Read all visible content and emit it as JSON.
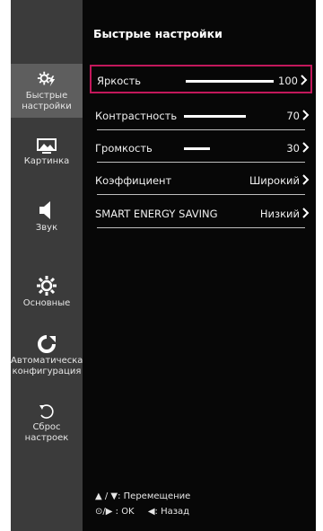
{
  "main": {
    "title": "Быстрые настройки"
  },
  "sidebar": {
    "items": [
      {
        "label": "Быстрые\nнастройки",
        "icon": "quick-settings-icon"
      },
      {
        "label": "Картинка",
        "icon": "picture-icon"
      },
      {
        "label": "Звук",
        "icon": "speaker-icon"
      },
      {
        "label": "Основные",
        "icon": "gear-icon"
      },
      {
        "label": "Автоматическая\nконфигурация",
        "icon": "auto-config-icon"
      },
      {
        "label": "Сброс\nнастроек",
        "icon": "reset-icon"
      }
    ]
  },
  "settings": [
    {
      "label": "Яркость",
      "value": "100",
      "level": 1.0
    },
    {
      "label": "Контрастность",
      "value": "70",
      "level": 0.7
    },
    {
      "label": "Громкость",
      "value": "30",
      "level": 0.3
    },
    {
      "label": "Коэффициент",
      "value": "Широкий"
    },
    {
      "label": "SMART ENERGY SAVING",
      "value": "Низкий"
    }
  ],
  "footer": {
    "move_symbol": "▲ / ▼",
    "move_label": ": Перемещение",
    "ok_symbol": "⊙/▶",
    "ok_label": ": OK",
    "back_symbol": "◀",
    "back_label": ": Назад"
  },
  "colors": {
    "sidebar_bg": "#3b3b3b",
    "main_bg": "#070707",
    "selection": "#c2185b"
  }
}
